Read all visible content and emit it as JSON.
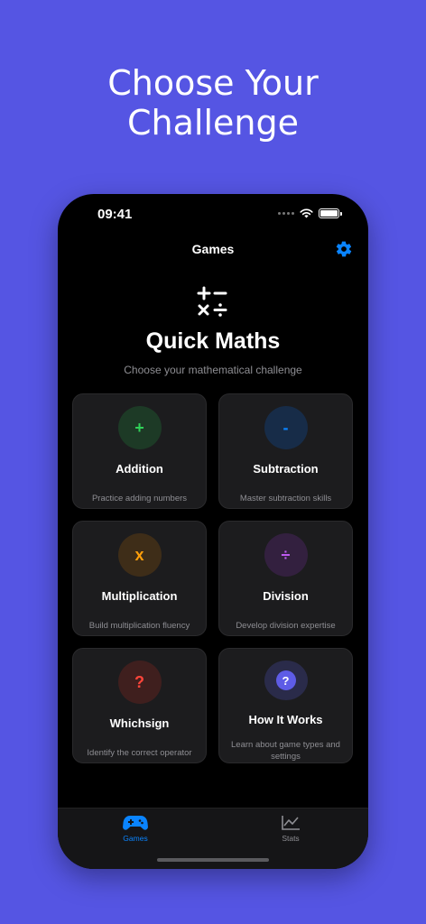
{
  "headline": {
    "line1": "Choose Your",
    "line2": "Challenge"
  },
  "status_bar": {
    "time": "09:41"
  },
  "nav": {
    "title": "Games"
  },
  "hero": {
    "title": "Quick Maths",
    "subtitle": "Choose your mathematical challenge"
  },
  "cards": [
    {
      "symbol": "+",
      "title": "Addition",
      "description": "Practice adding numbers",
      "color": "#30d158",
      "bg": "#1d3a26"
    },
    {
      "symbol": "-",
      "title": "Subtraction",
      "description": "Master subtraction skills",
      "color": "#0a84ff",
      "bg": "#172c48"
    },
    {
      "symbol": "x",
      "title": "Multiplication",
      "description": "Build multiplication fluency",
      "color": "#ff9f0a",
      "bg": "#3e2d18"
    },
    {
      "symbol": "÷",
      "title": "Division",
      "description": "Develop division expertise",
      "color": "#bf5af2",
      "bg": "#33203f"
    },
    {
      "symbol": "?",
      "title": "Whichsign",
      "description": "Identify the correct operator",
      "color": "#ff453a",
      "bg": "#3f1f1e"
    },
    {
      "symbol": "?",
      "title": "How It Works",
      "description": "Learn about game types and settings",
      "color": "#ffffff",
      "bg": "#2a2b4a",
      "badge": "#5e5ce6"
    }
  ],
  "tabs": {
    "games": {
      "label": "Games",
      "color": "#0a84ff"
    },
    "stats": {
      "label": "Stats",
      "color": "#8e8e93"
    }
  },
  "colors": {
    "accent": "#0a84ff",
    "background": "#5555e3"
  }
}
